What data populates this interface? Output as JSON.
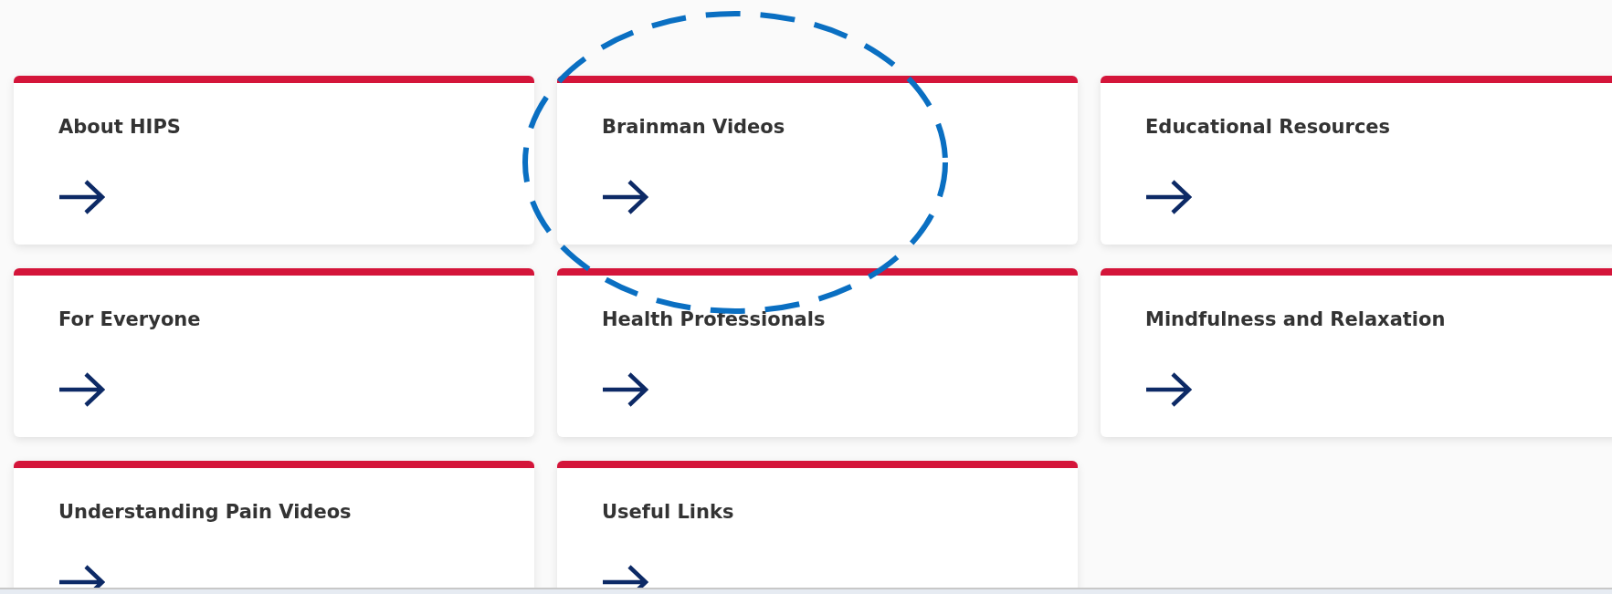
{
  "cards": [
    {
      "title": "About HIPS"
    },
    {
      "title": "Brainman Videos"
    },
    {
      "title": "Educational Resources"
    },
    {
      "title": "For Everyone"
    },
    {
      "title": "Health Professionals"
    },
    {
      "title": "Mindfulness and Relaxation"
    },
    {
      "title": "Understanding Pain Videos"
    },
    {
      "title": "Useful Links"
    }
  ]
}
